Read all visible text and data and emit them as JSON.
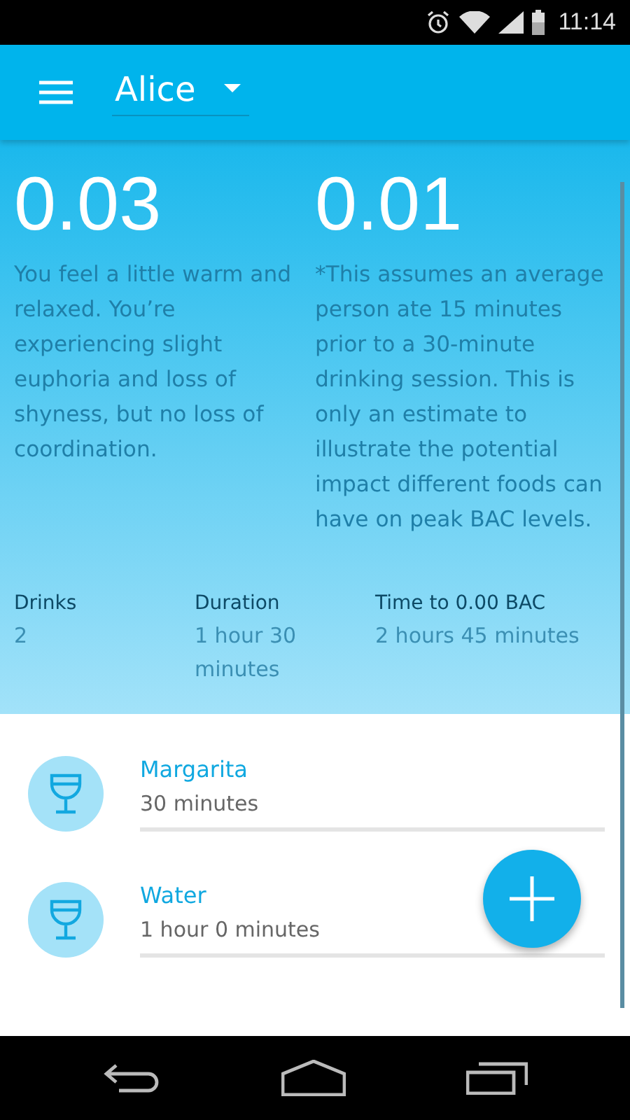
{
  "status_bar": {
    "time": "11:14"
  },
  "app_bar": {
    "user": "Alice"
  },
  "bac": [
    {
      "value": "0.03",
      "text": "You feel a little warm and relaxed. You’re experiencing slight euphoria and loss of shyness, but no loss of coordination."
    },
    {
      "value": "0.01",
      "text": "*This assumes an average person ate 15 minutes prior to a 30-minute drinking session. This is only an estimate to illustrate the potential impact different foods can have on peak BAC levels."
    }
  ],
  "stats": [
    {
      "label": "Drinks",
      "value": "2"
    },
    {
      "label": "Duration",
      "value": "1 hour 30 minutes"
    },
    {
      "label": "Time to 0.00 BAC",
      "value": "2 hours 45 minutes"
    }
  ],
  "drinks": [
    {
      "name": "Margarita",
      "time": "30 minutes"
    },
    {
      "name": "Water",
      "time": "1 hour 0 minutes"
    }
  ]
}
